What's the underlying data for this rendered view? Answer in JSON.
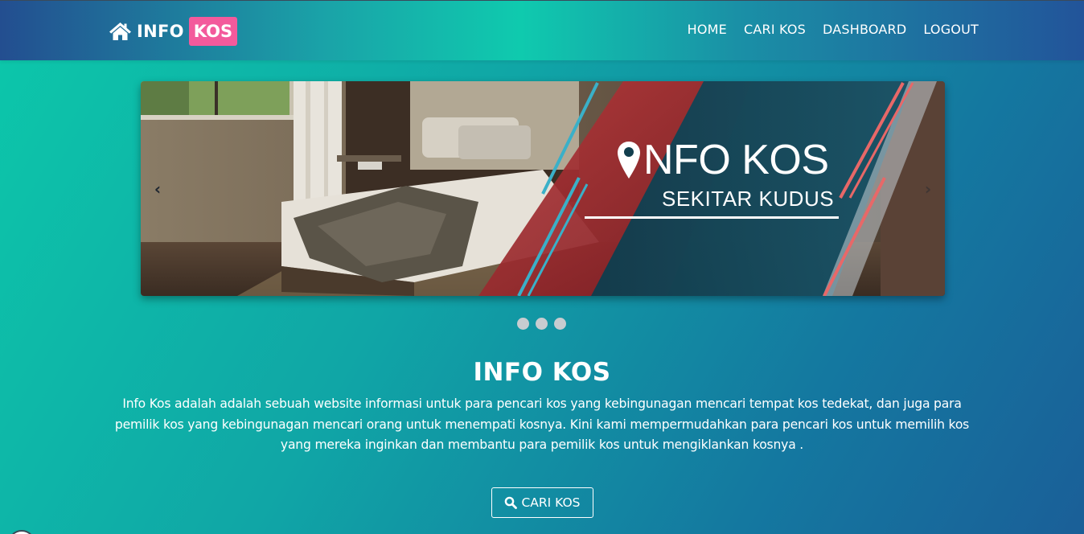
{
  "navbar": {
    "brand_text": "INFO",
    "brand_badge": "KOS",
    "links": [
      "HOME",
      "CARI KOS",
      "DASHBOARD",
      "LOGOUT"
    ]
  },
  "carousel": {
    "slide_title": "NFO KOS",
    "slide_subtitle": "SEKITAR KUDUS",
    "prev_label": "‹",
    "next_label": "›",
    "slide_count": 3
  },
  "content": {
    "headline": "INFO KOS",
    "description": "Info Kos adalah adalah sebuah website informasi untuk para pencari kos yang kebingunagan mencari tempat kos tedekat, dan juga para pemilik kos yang kebingunagan mencari orang untuk menempati kosnya. Kini kami mempermudahkan para pencari kos untuk memilih kos yang mereka inginkan dan membantu para pemilik kos untuk mengiklankan kosnya .",
    "cta_label": "CARI KOS"
  },
  "colors": {
    "badge": "#f35a9c",
    "accent_red": "#a82a2c",
    "accent_teal": "#0fcaae"
  },
  "icons": {
    "brand": "home-icon",
    "slide": "map-pin-icon",
    "cta": "search-icon"
  }
}
